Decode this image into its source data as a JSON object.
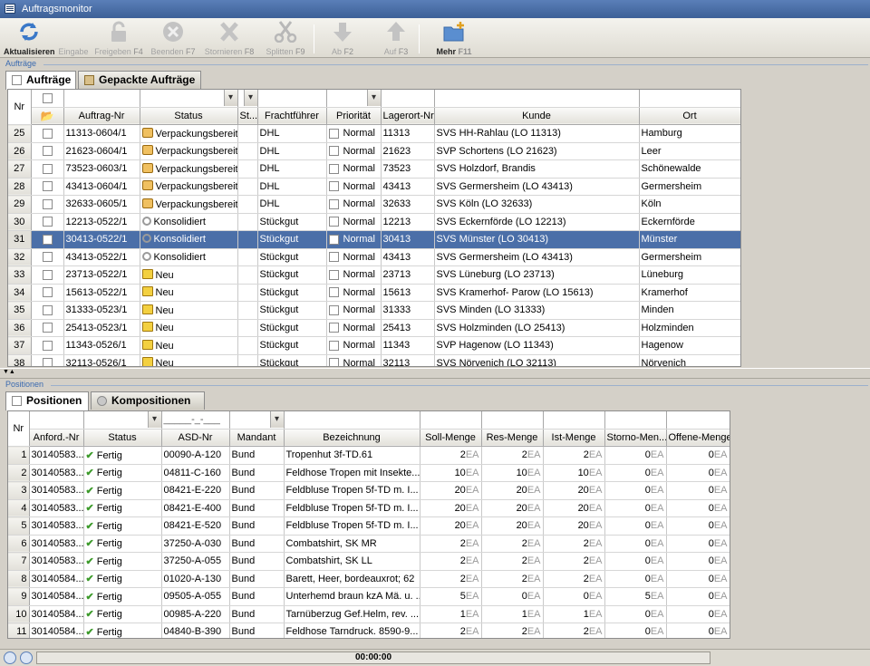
{
  "window": {
    "title": "Auftragsmonitor"
  },
  "toolbar": {
    "buttons": [
      {
        "label": "Aktualisieren",
        "key": "",
        "icon": "refresh-icon",
        "enabled": true
      },
      {
        "label": "Eingabe",
        "key": "",
        "icon": "",
        "enabled": false
      },
      {
        "label": "Freigeben",
        "key": "F4",
        "icon": "unlock-icon",
        "enabled": false
      },
      {
        "label": "Beenden",
        "key": "F7",
        "icon": "stop-icon",
        "enabled": false
      },
      {
        "label": "Stornieren",
        "key": "F8",
        "icon": "x-icon",
        "enabled": false
      },
      {
        "label": "Splitten",
        "key": "F9",
        "icon": "scissors-icon",
        "enabled": false
      },
      {
        "label": "Ab",
        "key": "F2",
        "icon": "arrow-down-icon",
        "enabled": false
      },
      {
        "label": "Auf",
        "key": "F3",
        "icon": "arrow-up-icon",
        "enabled": false
      },
      {
        "label": "Mehr",
        "key": "F11",
        "icon": "folder-plus-icon",
        "enabled": true
      }
    ]
  },
  "orders": {
    "section_label": "Aufträge",
    "tabs": [
      "Aufträge",
      "Gepackte Aufträge"
    ],
    "columns": [
      "Nr",
      "",
      "Auftrag-Nr",
      "Status",
      "St...",
      "Frachtführer",
      "Priorität",
      "Lagerort-Nr",
      "Kunde",
      "Ort"
    ],
    "rows": [
      {
        "nr": "25",
        "auftrag": "11313-0604/1",
        "status": "Verpackungsbereit",
        "status_icon": "pack",
        "fracht": "DHL",
        "prio": "Normal",
        "lager": "11313",
        "kunde": "SVS HH-Rahlau (LO 11313)",
        "ort": "Hamburg"
      },
      {
        "nr": "26",
        "auftrag": "21623-0604/1",
        "status": "Verpackungsbereit",
        "status_icon": "pack",
        "fracht": "DHL",
        "prio": "Normal",
        "lager": "21623",
        "kunde": "SVP Schortens (LO 21623)",
        "ort": "Leer"
      },
      {
        "nr": "27",
        "auftrag": "73523-0603/1",
        "status": "Verpackungsbereit",
        "status_icon": "pack",
        "fracht": "DHL",
        "prio": "Normal",
        "lager": "73523",
        "kunde": "SVS Holzdorf, Brandis",
        "ort": "Schönewalde"
      },
      {
        "nr": "28",
        "auftrag": "43413-0604/1",
        "status": "Verpackungsbereit",
        "status_icon": "pack",
        "fracht": "DHL",
        "prio": "Normal",
        "lager": "43413",
        "kunde": "SVS Germersheim (LO 43413)",
        "ort": "Germersheim"
      },
      {
        "nr": "29",
        "auftrag": "32633-0605/1",
        "status": "Verpackungsbereit",
        "status_icon": "pack",
        "fracht": "DHL",
        "prio": "Normal",
        "lager": "32633",
        "kunde": "SVS Köln (LO 32633)",
        "ort": "Köln"
      },
      {
        "nr": "30",
        "auftrag": "12213-0522/1",
        "status": "Konsolidiert",
        "status_icon": "key",
        "fracht": "Stückgut",
        "prio": "Normal",
        "lager": "12213",
        "kunde": "SVS Eckernförde (LO 12213)",
        "ort": "Eckernförde"
      },
      {
        "nr": "31",
        "auftrag": "30413-0522/1",
        "status": "Konsolidiert",
        "status_icon": "key",
        "fracht": "Stückgut",
        "prio": "Normal",
        "lager": "30413",
        "kunde": "SVS Münster (LO 30413)",
        "ort": "Münster",
        "selected": true
      },
      {
        "nr": "32",
        "auftrag": "43413-0522/1",
        "status": "Konsolidiert",
        "status_icon": "key",
        "fracht": "Stückgut",
        "prio": "Normal",
        "lager": "43413",
        "kunde": "SVS Germersheim (LO 43413)",
        "ort": "Germersheim"
      },
      {
        "nr": "33",
        "auftrag": "23713-0522/1",
        "status": "Neu",
        "status_icon": "lock",
        "fracht": "Stückgut",
        "prio": "Normal",
        "lager": "23713",
        "kunde": "SVS Lüneburg (LO 23713)",
        "ort": "Lüneburg"
      },
      {
        "nr": "34",
        "auftrag": "15613-0522/1",
        "status": "Neu",
        "status_icon": "lock",
        "fracht": "Stückgut",
        "prio": "Normal",
        "lager": "15613",
        "kunde": "SVS Kramerhof- Parow (LO 15613)",
        "ort": "Kramerhof"
      },
      {
        "nr": "35",
        "auftrag": "31333-0523/1",
        "status": "Neu",
        "status_icon": "lock",
        "fracht": "Stückgut",
        "prio": "Normal",
        "lager": "31333",
        "kunde": "SVS Minden (LO 31333)",
        "ort": "Minden"
      },
      {
        "nr": "36",
        "auftrag": "25413-0523/1",
        "status": "Neu",
        "status_icon": "lock",
        "fracht": "Stückgut",
        "prio": "Normal",
        "lager": "25413",
        "kunde": "SVS Holzminden (LO 25413)",
        "ort": "Holzminden"
      },
      {
        "nr": "37",
        "auftrag": "11343-0526/1",
        "status": "Neu",
        "status_icon": "lock",
        "fracht": "Stückgut",
        "prio": "Normal",
        "lager": "11343",
        "kunde": "SVP Hagenow (LO 11343)",
        "ort": "Hagenow"
      },
      {
        "nr": "38",
        "auftrag": "32113-0526/1",
        "status": "Neu",
        "status_icon": "lock",
        "fracht": "Stückgut",
        "prio": "Normal",
        "lager": "32113",
        "kunde": "SVS Nörvenich (LO 32113)",
        "ort": "Nörvenich"
      }
    ]
  },
  "positions": {
    "section_label": "Positionen",
    "tabs": [
      "Positionen",
      "Kompositionen"
    ],
    "asd_filter_placeholder": "_____-_-___",
    "columns": [
      "Nr",
      "Anford.-Nr",
      "Status",
      "ASD-Nr",
      "Mandant",
      "Bezeichnung",
      "Soll-Menge",
      "Res-Menge",
      "Ist-Menge",
      "Storno-Men...",
      "Offene-Menge"
    ],
    "unit": "EA",
    "rows": [
      {
        "nr": "1",
        "anford": "30140583...",
        "status": "Fertig",
        "asd": "00090-A-120",
        "mandant": "Bund",
        "bez": "Tropenhut 3f-TD.61",
        "soll": "2",
        "res": "2",
        "ist": "2",
        "storno": "0",
        "offen": "0"
      },
      {
        "nr": "2",
        "anford": "30140583...",
        "status": "Fertig",
        "asd": "04811-C-160",
        "mandant": "Bund",
        "bez": "Feldhose Tropen mit Insekte...",
        "soll": "10",
        "res": "10",
        "ist": "10",
        "storno": "0",
        "offen": "0"
      },
      {
        "nr": "3",
        "anford": "30140583...",
        "status": "Fertig",
        "asd": "08421-E-220",
        "mandant": "Bund",
        "bez": "Feldbluse Tropen 5f-TD m. I...",
        "soll": "20",
        "res": "20",
        "ist": "20",
        "storno": "0",
        "offen": "0"
      },
      {
        "nr": "4",
        "anford": "30140583...",
        "status": "Fertig",
        "asd": "08421-E-400",
        "mandant": "Bund",
        "bez": "Feldbluse Tropen 5f-TD m. I...",
        "soll": "20",
        "res": "20",
        "ist": "20",
        "storno": "0",
        "offen": "0"
      },
      {
        "nr": "5",
        "anford": "30140583...",
        "status": "Fertig",
        "asd": "08421-E-520",
        "mandant": "Bund",
        "bez": "Feldbluse Tropen 5f-TD m. I...",
        "soll": "20",
        "res": "20",
        "ist": "20",
        "storno": "0",
        "offen": "0"
      },
      {
        "nr": "6",
        "anford": "30140583...",
        "status": "Fertig",
        "asd": "37250-A-030",
        "mandant": "Bund",
        "bez": "Combatshirt, SK MR",
        "soll": "2",
        "res": "2",
        "ist": "2",
        "storno": "0",
        "offen": "0"
      },
      {
        "nr": "7",
        "anford": "30140583...",
        "status": "Fertig",
        "asd": "37250-A-055",
        "mandant": "Bund",
        "bez": "Combatshirt, SK LL",
        "soll": "2",
        "res": "2",
        "ist": "2",
        "storno": "0",
        "offen": "0"
      },
      {
        "nr": "8",
        "anford": "30140584...",
        "status": "Fertig",
        "asd": "01020-A-130",
        "mandant": "Bund",
        "bez": "Barett, Heer, bordeauxrot; 62",
        "soll": "2",
        "res": "2",
        "ist": "2",
        "storno": "0",
        "offen": "0"
      },
      {
        "nr": "9",
        "anford": "30140584...",
        "status": "Fertig",
        "asd": "09505-A-055",
        "mandant": "Bund",
        "bez": "Unterhemd braun kzA Mä. u. ...",
        "soll": "5",
        "res": "0",
        "ist": "0",
        "storno": "5",
        "offen": "0"
      },
      {
        "nr": "10",
        "anford": "30140584...",
        "status": "Fertig",
        "asd": "00985-A-220",
        "mandant": "Bund",
        "bez": "Tarnüberzug Gef.Helm, rev. ...",
        "soll": "1",
        "res": "1",
        "ist": "1",
        "storno": "0",
        "offen": "0"
      },
      {
        "nr": "11",
        "anford": "30140584...",
        "status": "Fertig",
        "asd": "04840-B-390",
        "mandant": "Bund",
        "bez": "Feldhose Tarndruck. 8590-9...",
        "soll": "2",
        "res": "2",
        "ist": "2",
        "storno": "0",
        "offen": "0"
      }
    ]
  },
  "status": {
    "timer": "00:00:00"
  }
}
